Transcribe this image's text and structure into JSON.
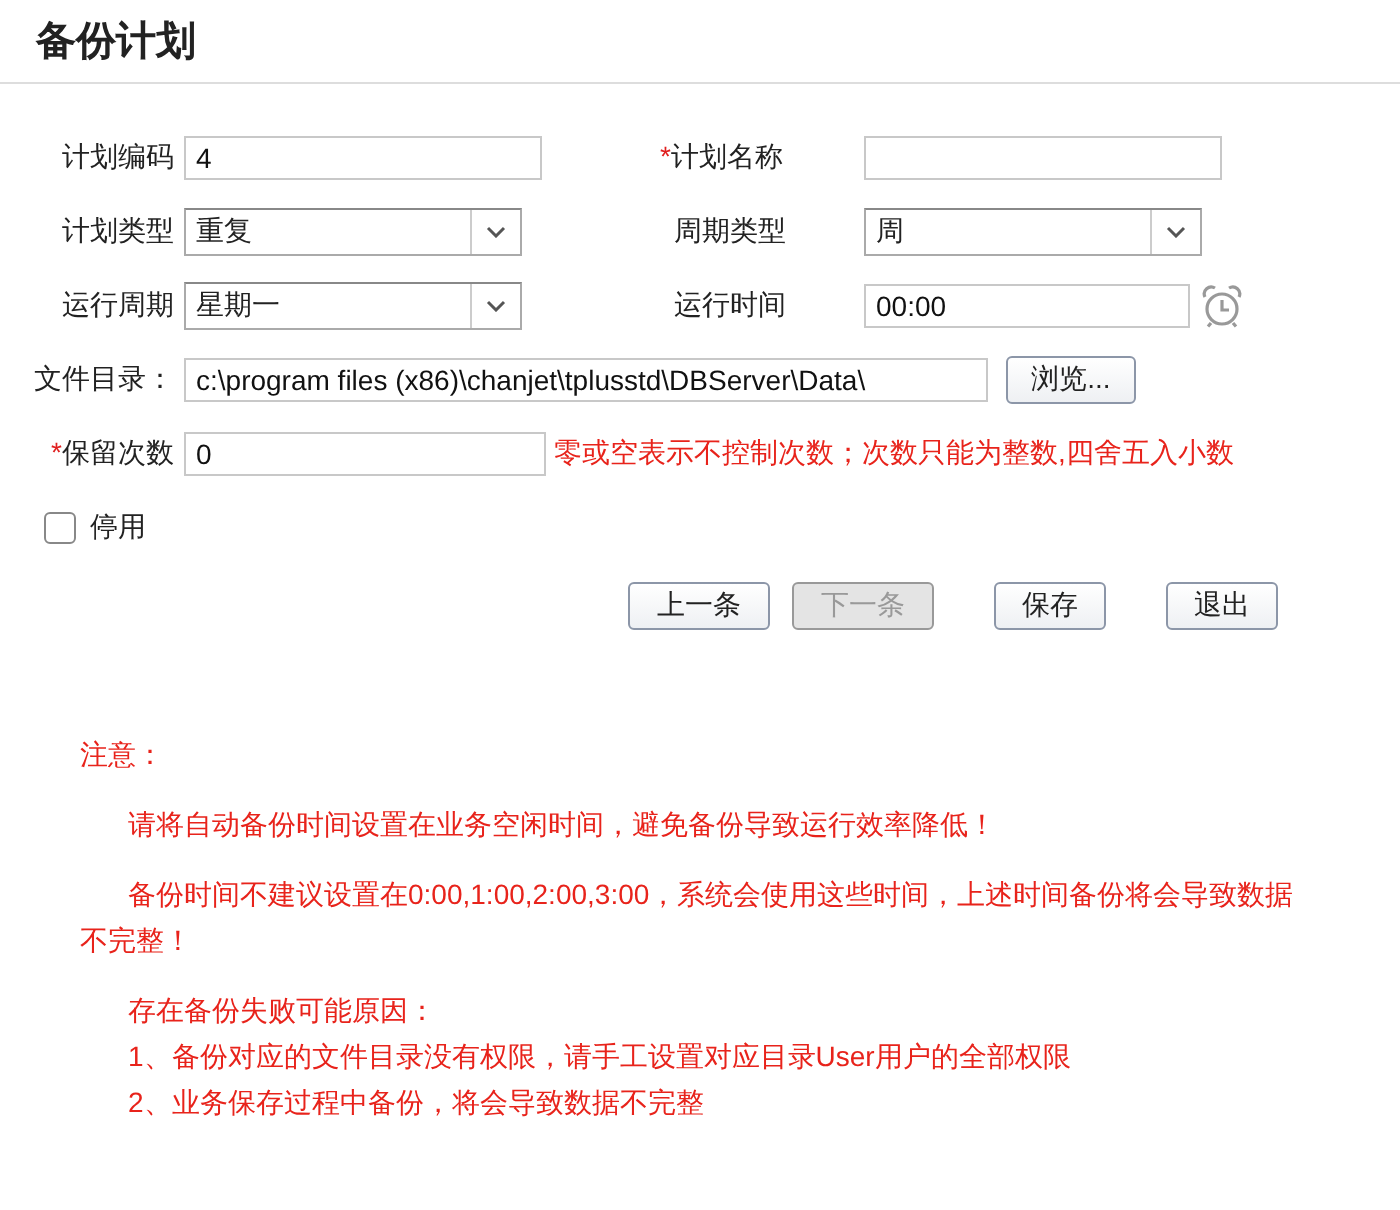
{
  "title": "备份计划",
  "rows": [
    {
      "fields": [
        {
          "kind": "text",
          "label": "计划编码",
          "value": "4"
        },
        {
          "kind": "text",
          "marker": "*",
          "label": "计划名称"
        }
      ]
    },
    {
      "fields": [
        {
          "kind": "select",
          "label": "计划类型",
          "value": "重复"
        },
        {
          "kind": "select",
          "label": "周期类型",
          "value": "周"
        }
      ]
    },
    {
      "fields": [
        {
          "kind": "select",
          "label": "运行周期",
          "value": "星期一"
        },
        {
          "kind": "time",
          "label": "运行时间",
          "value": "00:00"
        }
      ]
    },
    {
      "fields": [
        {
          "kind": "path",
          "label": "文件目录：",
          "value": "c:\\program files (x86)\\chanjet\\tplusstd\\DBServer\\Data\\",
          "button": "浏览..."
        }
      ]
    },
    {
      "fields": [
        {
          "kind": "number",
          "marker": "*",
          "label": "保留次数",
          "value": "0",
          "hint": "零或空表示不控制次数；次数只能为整数,四舍五入小数"
        }
      ]
    }
  ],
  "checkbox": {
    "label": "停用",
    "checked": false
  },
  "buttons": [
    {
      "label": "上一条",
      "disabled": false
    },
    {
      "label": "下一条",
      "disabled": true
    },
    {
      "label": "保存",
      "disabled": false
    },
    {
      "label": "退出",
      "disabled": false
    }
  ],
  "notes": {
    "title": "注意：",
    "paragraphs": [
      {
        "lines": [
          "请将自动备份时间设置在业务空闲时间，避免备份导致运行效率降低！"
        ]
      },
      {
        "lines": [
          "备份时间不建议设置在0:00,1:00,2:00,3:00，系统会使用这些时间，上述时间备份将会导致数据不完整！"
        ]
      },
      {
        "lines": [
          "存在备份失败可能原因：",
          "1、备份对应的文件目录没有权限，请手工设置对应目录User用户的全部权限",
          "2、业务保存过程中备份，将会导致数据不完整"
        ]
      }
    ]
  }
}
